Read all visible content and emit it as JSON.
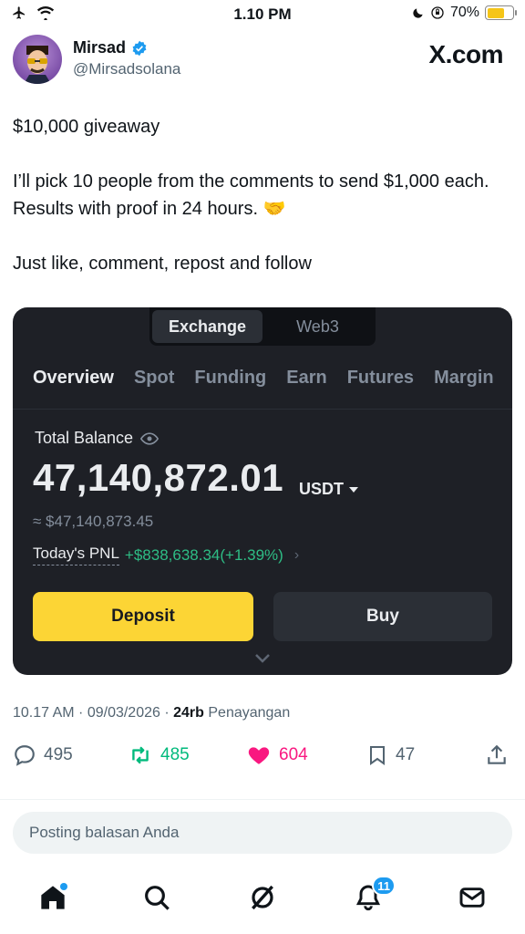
{
  "status_bar": {
    "time": "1.10 PM",
    "battery_percent": "70%",
    "battery_level": 0.7
  },
  "post": {
    "author_name": "Mirsad",
    "author_handle": "@Mirsadsolana",
    "brand": "X.com",
    "text_lines": [
      "$10,000 giveaway",
      "I’ll pick 10 people from the comments to send $1,000 each. Results with proof in 24 hours. 🤝",
      "Just like, comment, repost and follow"
    ]
  },
  "card": {
    "segments": [
      "Exchange",
      "Web3"
    ],
    "tabs": [
      "Overview",
      "Spot",
      "Funding",
      "Earn",
      "Futures",
      "Margin"
    ],
    "balance_label": "Total Balance",
    "balance_value": "47,140,872.01",
    "balance_unit": "USDT",
    "balance_usd": "≈ $47,140,873.45",
    "pnl_label": "Today's PNL",
    "pnl_value": "+$838,638.34(+1.39%)",
    "deposit_label": "Deposit",
    "buy_label": "Buy",
    "colors": {
      "bg": "#1e2026",
      "accent": "#fcd535",
      "positive": "#2ebd85"
    }
  },
  "meta": {
    "timestamp": "10.17 AM · 09/03/2026 · ",
    "views_count": "24rb",
    "views_label": " Penayangan"
  },
  "actions": {
    "replies": "495",
    "reposts": "485",
    "likes": "604",
    "bookmarks": "47"
  },
  "reply": {
    "placeholder": "Posting balasan Anda"
  },
  "nav": {
    "notifications_badge": "11",
    "icons": [
      "home-icon",
      "search-icon",
      "grok-icon",
      "bell-icon",
      "mail-icon"
    ]
  }
}
